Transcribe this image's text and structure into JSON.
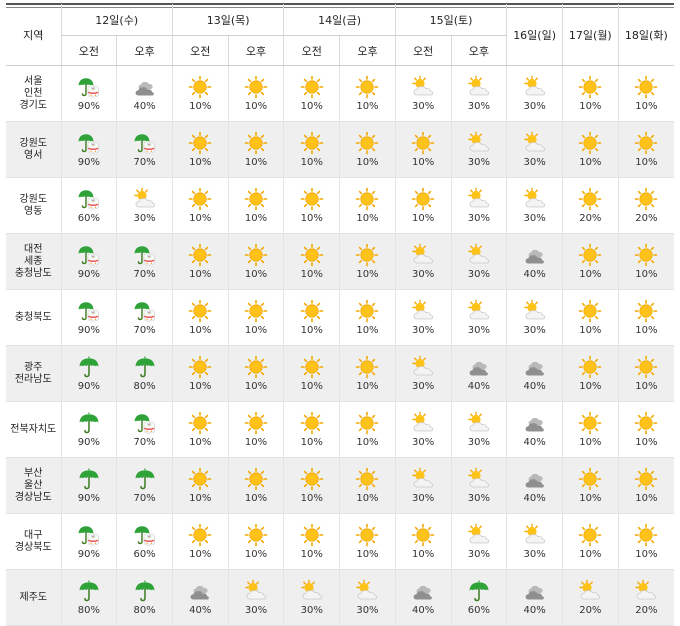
{
  "header": {
    "region": "지역",
    "days": [
      {
        "label": "12일(수)",
        "split": true
      },
      {
        "label": "13일(목)",
        "split": true
      },
      {
        "label": "14일(금)",
        "split": true
      },
      {
        "label": "15일(토)",
        "split": true
      },
      {
        "label": "16일(일)",
        "split": false
      },
      {
        "label": "17일(월)",
        "split": false
      },
      {
        "label": "18일(화)",
        "split": false
      }
    ],
    "am": "오전",
    "pm": "오후"
  },
  "rows": [
    {
      "region": [
        "서울",
        "인천",
        "경기도"
      ],
      "cells": [
        [
          "rain-snow-icon",
          "90%"
        ],
        [
          "cloudy-icon",
          "40%"
        ],
        [
          "sun-icon",
          "10%"
        ],
        [
          "sun-icon",
          "10%"
        ],
        [
          "sun-icon",
          "10%"
        ],
        [
          "sun-icon",
          "10%"
        ],
        [
          "partly-cloudy-icon",
          "30%"
        ],
        [
          "partly-cloudy-icon",
          "30%"
        ],
        [
          "partly-cloudy-icon",
          "30%"
        ],
        [
          "sun-icon",
          "10%"
        ],
        [
          "sun-icon",
          "10%"
        ]
      ]
    },
    {
      "region": [
        "강원도",
        "영서"
      ],
      "cells": [
        [
          "rain-snow-icon",
          "90%"
        ],
        [
          "rain-snow-icon",
          "70%"
        ],
        [
          "sun-icon",
          "10%"
        ],
        [
          "sun-icon",
          "10%"
        ],
        [
          "sun-icon",
          "10%"
        ],
        [
          "sun-icon",
          "10%"
        ],
        [
          "sun-icon",
          "10%"
        ],
        [
          "partly-cloudy-icon",
          "30%"
        ],
        [
          "partly-cloudy-icon",
          "30%"
        ],
        [
          "sun-icon",
          "10%"
        ],
        [
          "sun-icon",
          "10%"
        ]
      ]
    },
    {
      "region": [
        "강원도",
        "영동"
      ],
      "cells": [
        [
          "rain-snow-icon",
          "60%"
        ],
        [
          "partly-cloudy-icon",
          "30%"
        ],
        [
          "sun-icon",
          "10%"
        ],
        [
          "sun-icon",
          "10%"
        ],
        [
          "sun-icon",
          "10%"
        ],
        [
          "sun-icon",
          "10%"
        ],
        [
          "sun-icon",
          "10%"
        ],
        [
          "partly-cloudy-icon",
          "30%"
        ],
        [
          "partly-cloudy-icon",
          "30%"
        ],
        [
          "sun-icon",
          "20%"
        ],
        [
          "sun-icon",
          "20%"
        ]
      ]
    },
    {
      "region": [
        "대전",
        "세종",
        "충청남도"
      ],
      "cells": [
        [
          "rain-snow-icon",
          "90%"
        ],
        [
          "rain-snow-icon",
          "70%"
        ],
        [
          "sun-icon",
          "10%"
        ],
        [
          "sun-icon",
          "10%"
        ],
        [
          "sun-icon",
          "10%"
        ],
        [
          "sun-icon",
          "10%"
        ],
        [
          "partly-cloudy-icon",
          "30%"
        ],
        [
          "partly-cloudy-icon",
          "30%"
        ],
        [
          "cloudy-icon",
          "40%"
        ],
        [
          "sun-icon",
          "10%"
        ],
        [
          "sun-icon",
          "10%"
        ]
      ]
    },
    {
      "region": [
        "충청북도"
      ],
      "cells": [
        [
          "rain-snow-icon",
          "90%"
        ],
        [
          "rain-snow-icon",
          "70%"
        ],
        [
          "sun-icon",
          "10%"
        ],
        [
          "sun-icon",
          "10%"
        ],
        [
          "sun-icon",
          "10%"
        ],
        [
          "sun-icon",
          "10%"
        ],
        [
          "partly-cloudy-icon",
          "30%"
        ],
        [
          "partly-cloudy-icon",
          "30%"
        ],
        [
          "partly-cloudy-icon",
          "30%"
        ],
        [
          "sun-icon",
          "10%"
        ],
        [
          "sun-icon",
          "10%"
        ]
      ]
    },
    {
      "region": [
        "광주",
        "전라남도"
      ],
      "cells": [
        [
          "umbrella-icon",
          "90%"
        ],
        [
          "umbrella-icon",
          "80%"
        ],
        [
          "sun-icon",
          "10%"
        ],
        [
          "sun-icon",
          "10%"
        ],
        [
          "sun-icon",
          "10%"
        ],
        [
          "sun-icon",
          "10%"
        ],
        [
          "partly-cloudy-icon",
          "30%"
        ],
        [
          "cloudy-icon",
          "40%"
        ],
        [
          "cloudy-icon",
          "40%"
        ],
        [
          "sun-icon",
          "10%"
        ],
        [
          "sun-icon",
          "10%"
        ]
      ]
    },
    {
      "region": [
        "전북자치도"
      ],
      "cells": [
        [
          "umbrella-icon",
          "90%"
        ],
        [
          "rain-snow-icon",
          "70%"
        ],
        [
          "sun-icon",
          "10%"
        ],
        [
          "sun-icon",
          "10%"
        ],
        [
          "sun-icon",
          "10%"
        ],
        [
          "sun-icon",
          "10%"
        ],
        [
          "partly-cloudy-icon",
          "30%"
        ],
        [
          "partly-cloudy-icon",
          "30%"
        ],
        [
          "cloudy-icon",
          "40%"
        ],
        [
          "sun-icon",
          "10%"
        ],
        [
          "sun-icon",
          "10%"
        ]
      ]
    },
    {
      "region": [
        "부산",
        "울산",
        "경상남도"
      ],
      "cells": [
        [
          "umbrella-icon",
          "90%"
        ],
        [
          "umbrella-icon",
          "70%"
        ],
        [
          "sun-icon",
          "10%"
        ],
        [
          "sun-icon",
          "10%"
        ],
        [
          "sun-icon",
          "10%"
        ],
        [
          "sun-icon",
          "10%"
        ],
        [
          "partly-cloudy-icon",
          "30%"
        ],
        [
          "partly-cloudy-icon",
          "30%"
        ],
        [
          "cloudy-icon",
          "40%"
        ],
        [
          "sun-icon",
          "10%"
        ],
        [
          "sun-icon",
          "10%"
        ]
      ]
    },
    {
      "region": [
        "대구",
        "경상북도"
      ],
      "cells": [
        [
          "rain-snow-icon",
          "90%"
        ],
        [
          "rain-snow-icon",
          "60%"
        ],
        [
          "sun-icon",
          "10%"
        ],
        [
          "sun-icon",
          "10%"
        ],
        [
          "sun-icon",
          "10%"
        ],
        [
          "sun-icon",
          "10%"
        ],
        [
          "sun-icon",
          "10%"
        ],
        [
          "partly-cloudy-icon",
          "30%"
        ],
        [
          "partly-cloudy-icon",
          "30%"
        ],
        [
          "sun-icon",
          "10%"
        ],
        [
          "sun-icon",
          "10%"
        ]
      ]
    },
    {
      "region": [
        "제주도"
      ],
      "cells": [
        [
          "umbrella-icon",
          "80%"
        ],
        [
          "umbrella-icon",
          "80%"
        ],
        [
          "cloudy-icon",
          "40%"
        ],
        [
          "partly-cloudy-icon",
          "30%"
        ],
        [
          "partly-cloudy-icon",
          "30%"
        ],
        [
          "partly-cloudy-icon",
          "30%"
        ],
        [
          "cloudy-icon",
          "40%"
        ],
        [
          "umbrella-icon",
          "60%"
        ],
        [
          "cloudy-icon",
          "40%"
        ],
        [
          "partly-cloudy-icon",
          "20%"
        ],
        [
          "partly-cloudy-icon",
          "20%"
        ]
      ]
    }
  ]
}
